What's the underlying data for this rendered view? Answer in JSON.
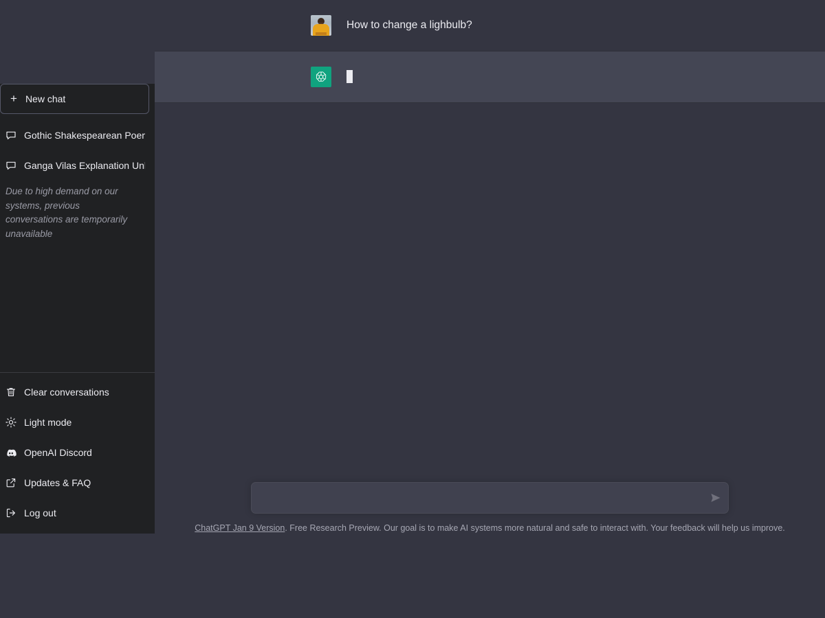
{
  "theme": {
    "page_bg": "#343541",
    "sidebar_bg": "#202123",
    "assistant_row_bg": "#444654",
    "brand_green": "#10a37f",
    "composer_bg": "#40414f",
    "text_primary": "#ececf1",
    "text_muted": "#a6a7b3"
  },
  "sidebar": {
    "new_chat": {
      "label": "New chat",
      "icon": "plus-icon"
    },
    "conversations": [
      {
        "label": "Gothic Shakespearean Poem",
        "icon": "chat-bubble-icon"
      },
      {
        "label": "Ganga Vilas Explanation Unkn",
        "icon": "chat-bubble-icon"
      }
    ],
    "notice": "Due to high demand on our systems, previous conversations are temporarily unavailable",
    "footer_items": [
      {
        "label": "Clear conversations",
        "icon": "trash-icon"
      },
      {
        "label": "Light mode",
        "icon": "sun-icon"
      },
      {
        "label": "OpenAI Discord",
        "icon": "discord-icon"
      },
      {
        "label": "Updates & FAQ",
        "icon": "external-link-icon"
      },
      {
        "label": "Log out",
        "icon": "logout-icon"
      }
    ]
  },
  "conversation": {
    "messages": [
      {
        "role": "user",
        "avatar": "user-photo-avatar",
        "text": "How to change a lighbulb?"
      },
      {
        "role": "assistant",
        "avatar": "chatgpt-logo-icon",
        "text": "",
        "streaming_caret": true
      }
    ]
  },
  "composer": {
    "value": "",
    "placeholder": "",
    "send_icon": "send-paper-plane-icon"
  },
  "footer": {
    "link_text": "ChatGPT Jan 9 Version",
    "rest_text": ". Free Research Preview. Our goal is to make AI systems more natural and safe to interact with. Your feedback will help us improve."
  }
}
